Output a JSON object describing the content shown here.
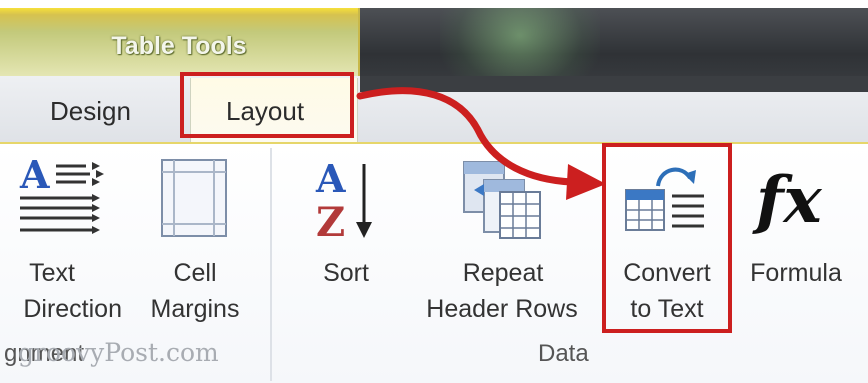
{
  "contextual_tab": "Table Tools",
  "tabs": [
    {
      "label": "Design"
    },
    {
      "label": "Layout",
      "selected": true
    }
  ],
  "buttons": {
    "text_direction": {
      "line1": "Text",
      "line2": "Direction",
      "icon": "text-direction-icon"
    },
    "cell_margins": {
      "line1": "Cell",
      "line2": "Margins",
      "icon": "cell-margins-icon"
    },
    "sort": {
      "line1": "Sort",
      "icon": "sort-az-icon"
    },
    "repeat_header_rows": {
      "line1": "Repeat",
      "line2": "Header Rows",
      "icon": "repeat-header-rows-icon"
    },
    "convert_to_text": {
      "line1": "Convert",
      "line2": "to Text",
      "icon": "convert-to-text-icon"
    },
    "formula": {
      "line1": "Formula",
      "icon": "fx-icon"
    }
  },
  "groups": {
    "alignment_partial": "gnment",
    "data": "Data"
  },
  "watermark": "groovyPost.com",
  "colors": {
    "highlight": "#cc1f1f",
    "table_tools": "#d6c24f"
  }
}
